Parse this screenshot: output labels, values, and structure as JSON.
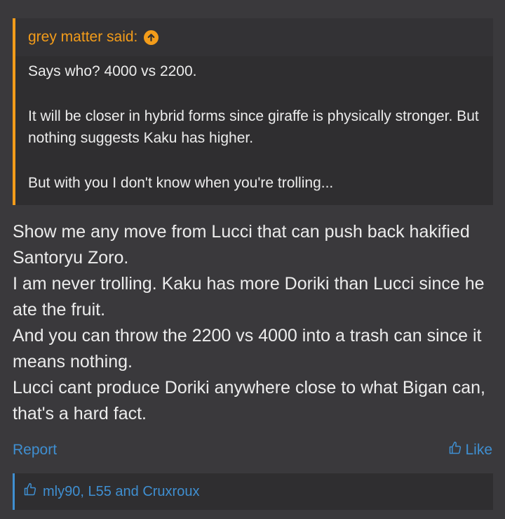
{
  "quote": {
    "author": "grey matter said:",
    "lines": [
      "Says who? 4000 vs 2200.",
      "It will be closer in hybrid forms since giraffe is physically stronger. But nothing suggests Kaku has higher.",
      "But with you I don't know when you're trolling..."
    ]
  },
  "post": {
    "lines": [
      "Show me any move from Lucci that can push back hakified Santoryu Zoro.",
      "I am never trolling. Kaku has more Doriki than Lucci since he ate the fruit.",
      "And you can throw the 2200 vs 4000 into a trash can since it means nothing.",
      "Lucci cant produce Doriki anywhere close to what Bigan can, that's a hard fact."
    ]
  },
  "actions": {
    "report": "Report",
    "like": "Like"
  },
  "likes": {
    "text": "mly90, L55 and Cruxroux"
  },
  "colors": {
    "accent_orange": "#f39c1a",
    "link_blue": "#3f8fd1",
    "background": "#3a393c"
  }
}
